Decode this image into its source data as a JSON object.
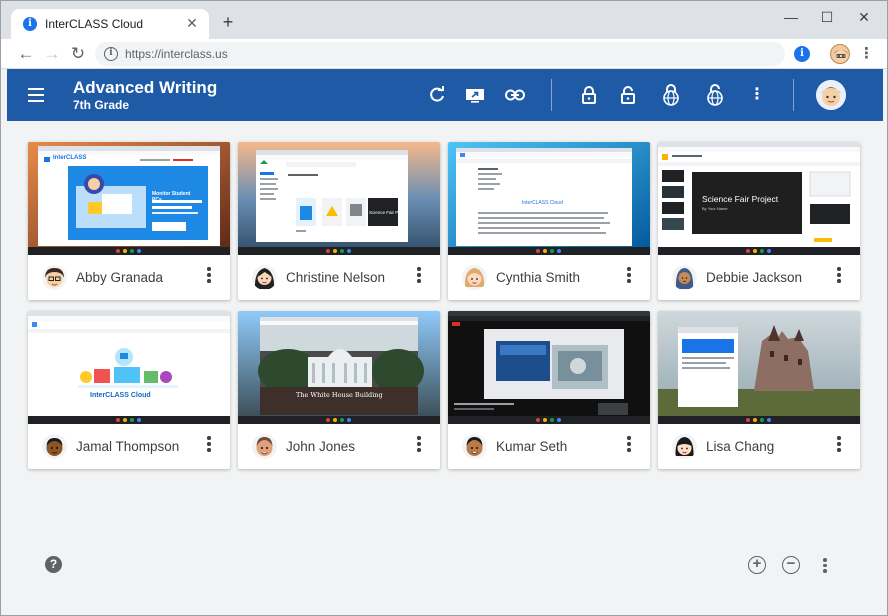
{
  "browser": {
    "tab_title": "InterCLASS Cloud",
    "tab_close": "✕",
    "new_tab": "+",
    "url": "https://interclass.us",
    "window_controls": {
      "minimize": "—",
      "maximize": "☐",
      "close": "✕"
    }
  },
  "app": {
    "class_title": "Advanced Writing",
    "class_subtitle": "7th Grade",
    "header_icons": [
      "refresh-icon",
      "share-screen-icon",
      "link-icon",
      "lock-icon",
      "unlock-icon",
      "lock-web-icon",
      "unlock-web-icon",
      "more-vert-icon"
    ]
  },
  "students": [
    {
      "name": "Abby Granada",
      "screen": "interclass-site"
    },
    {
      "name": "Christine Nelson",
      "screen": "google-drive"
    },
    {
      "name": "Cynthia Smith",
      "screen": "google-docs"
    },
    {
      "name": "Debbie Jackson",
      "screen": "google-slides"
    },
    {
      "name": "Jamal Thompson",
      "screen": "interclass-cloud-doc"
    },
    {
      "name": "John Jones",
      "screen": "white-house"
    },
    {
      "name": "Kumar Seth",
      "screen": "video-player"
    },
    {
      "name": "Lisa Chang",
      "screen": "castle-wallpaper"
    }
  ],
  "thumb_text": {
    "interclass_logo": "InterCLASS",
    "interclass_headline": "Monitor Student PCs",
    "drive_card": "Science Fair Pro",
    "docs_heading": "InterCLASS Cloud",
    "slides_title": "Science Fair Project",
    "slides_sub": "By Your Name",
    "cloud_doc_label": "InterCLASS Cloud",
    "white_house": "The White House Building"
  },
  "colors": {
    "app_header": "#1f5aa6",
    "background": "#f1f3f4",
    "accent": "#1a73e8"
  }
}
